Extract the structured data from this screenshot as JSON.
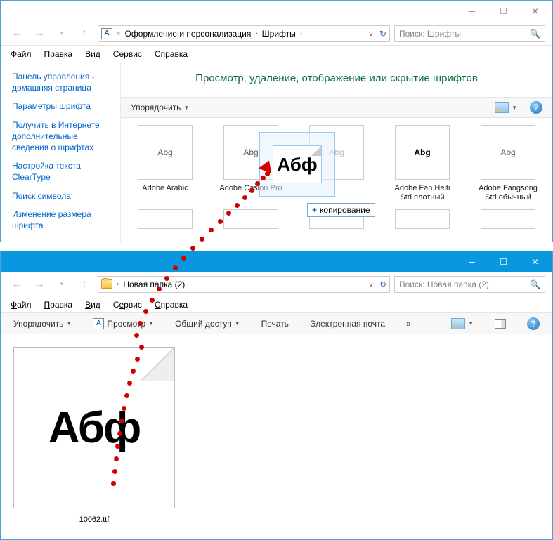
{
  "win1": {
    "titlebar_buttons": [
      "min",
      "max",
      "close"
    ],
    "nav_back": "←",
    "nav_fwd": "→",
    "nav_up": "↑",
    "breadcrumb": {
      "seg1": "Оформление и персонализация",
      "seg2": "Шрифты"
    },
    "search_placeholder": "Поиск: Шрифты",
    "menubar": {
      "file": "Файл",
      "edit": "Правка",
      "view": "Вид",
      "service": "Сервис",
      "help": "Справка"
    },
    "sidebar": {
      "items": [
        "Панель управления - домашняя страница",
        "Параметры шрифта",
        "Получить в Интернете дополнительные сведения о шрифтах",
        "Настройка текста ClearType",
        "Поиск символа",
        "Изменение размера шрифта"
      ]
    },
    "heading": "Просмотр, удаление, отображение или скрытие шрифтов",
    "toolbar": {
      "organize": "Упорядочить"
    },
    "fonts": [
      {
        "glyph": "Abg",
        "name": "Adobe Arabic",
        "style": "serif"
      },
      {
        "glyph": "Abg",
        "name": "Adobe Caslon Pro",
        "style": "serif"
      },
      {
        "glyph": "Abg",
        "name": "",
        "style": "serif-grey"
      },
      {
        "glyph": "Abg",
        "name": "Adobe Fan Heiti Std плотный",
        "style": "bold"
      },
      {
        "glyph": "Abg",
        "name": "Adobe Fangsong Std обычный",
        "style": "light"
      }
    ],
    "drag": {
      "glyph": "Абф",
      "copy_label": "копирование",
      "plus": "+"
    }
  },
  "win2": {
    "breadcrumb": {
      "seg1": "Новая папка (2)"
    },
    "search_placeholder": "Поиск: Новая папка (2)",
    "menubar": {
      "file": "Файл",
      "edit": "Правка",
      "view": "Вид",
      "service": "Сервис",
      "help": "Справка"
    },
    "toolbar": {
      "organize": "Упорядочить",
      "preview": "Просмотр",
      "share": "Общий доступ",
      "print": "Печать",
      "email": "Электронная почта",
      "more": "»"
    },
    "file": {
      "glyph": "Абф",
      "name": "10062.ttf"
    }
  }
}
